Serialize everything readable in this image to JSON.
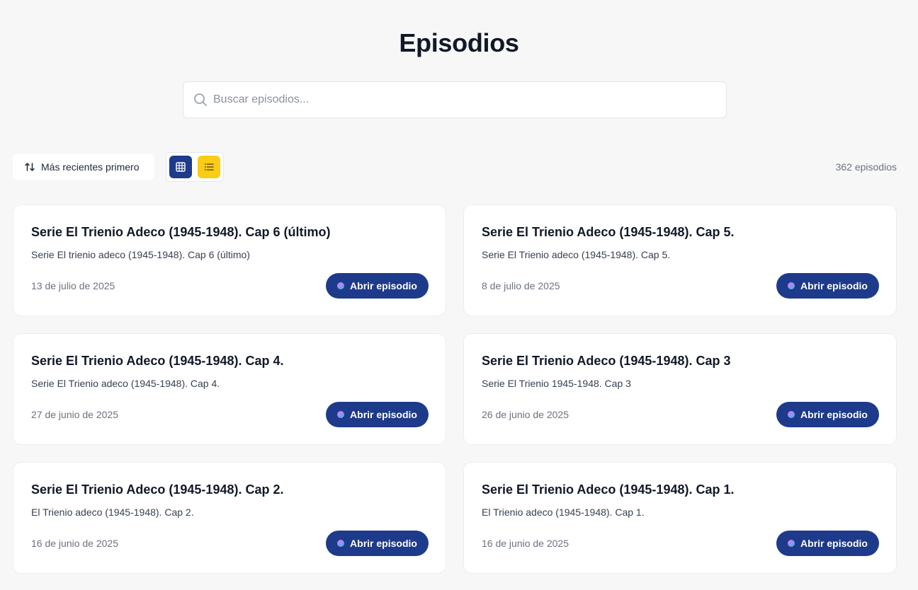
{
  "page": {
    "title": "Episodios"
  },
  "search": {
    "placeholder": "Buscar episodios...",
    "value": ""
  },
  "toolbar": {
    "sort_label": "Más recientes primero",
    "view_grid_icon": "grid-icon",
    "view_list_icon": "list-icon",
    "episode_count": "362 episodios"
  },
  "colors": {
    "accent": "#1e3a8a",
    "list_toggle": "#facc15",
    "background": "#f7f7f8"
  },
  "episodes": [
    {
      "title": "Serie El Trienio Adeco (1945-1948). Cap 6 (último)",
      "description": "Serie El trienio adeco (1945-1948). Cap 6 (último)",
      "date": "13 de julio de 2025",
      "button": "Abrir episodio"
    },
    {
      "title": "Serie El Trienio Adeco (1945-1948). Cap 5.",
      "description": "Serie El Trienio adeco (1945-1948). Cap 5.",
      "date": "8 de julio de 2025",
      "button": "Abrir episodio"
    },
    {
      "title": "Serie El Trienio Adeco (1945-1948). Cap 4.",
      "description": "Serie El Trienio adeco (1945-1948). Cap 4.",
      "date": "27 de junio de 2025",
      "button": "Abrir episodio"
    },
    {
      "title": "Serie El Trienio Adeco (1945-1948). Cap 3",
      "description": "Serie El Trienio 1945-1948. Cap 3",
      "date": "26 de junio de 2025",
      "button": "Abrir episodio"
    },
    {
      "title": "Serie El Trienio Adeco (1945-1948). Cap 2.",
      "description": "El Trienio adeco (1945-1948). Cap 2.",
      "date": "16 de junio de 2025",
      "button": "Abrir episodio"
    },
    {
      "title": "Serie El Trienio Adeco (1945-1948). Cap 1.",
      "description": "El Trienio adeco (1945-1948). Cap 1.",
      "date": "16 de junio de 2025",
      "button": "Abrir episodio"
    }
  ]
}
